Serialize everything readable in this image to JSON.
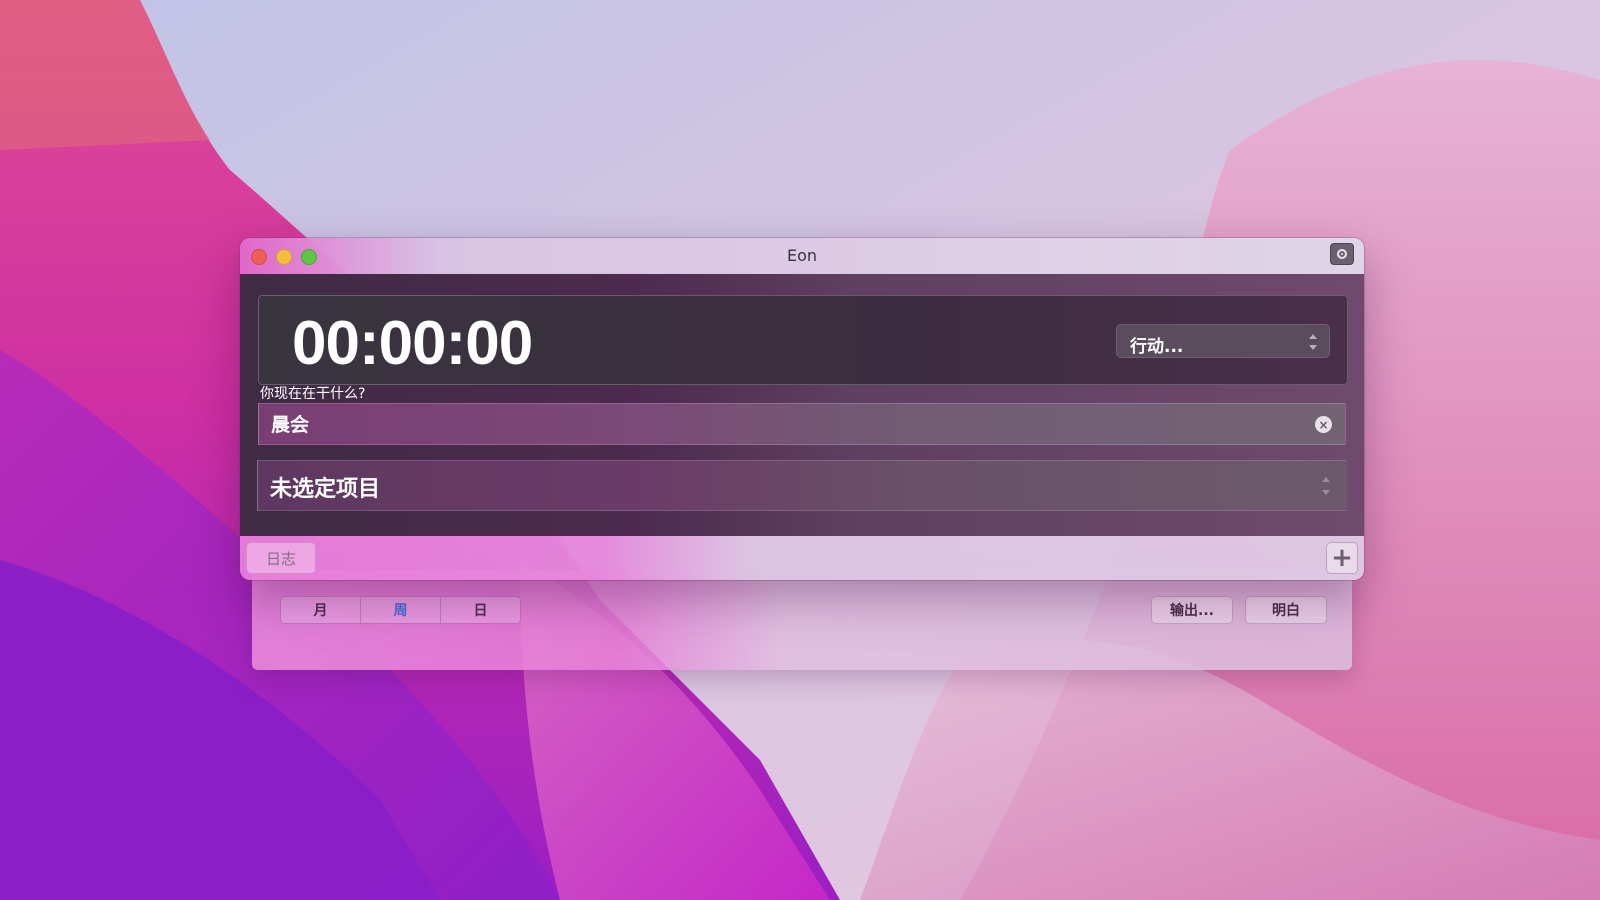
{
  "window": {
    "title": "Eon"
  },
  "timer": {
    "value": "00:00:00",
    "action_label": "行动..."
  },
  "activity": {
    "prompt": "你现在在干什么?",
    "value": "晨会",
    "clear_icon": "×"
  },
  "project": {
    "label": "未选定项目"
  },
  "bottombar": {
    "log_label": "日志",
    "add_icon": "+"
  },
  "log_panel": {
    "segments": [
      {
        "label": "月",
        "active": false
      },
      {
        "label": "周",
        "active": true
      },
      {
        "label": "日",
        "active": false
      }
    ],
    "export_label": "输出...",
    "tomorrow_label": "明白"
  },
  "icons": {
    "close": "traffic-close-icon",
    "minimize": "traffic-minimize-icon",
    "zoom": "traffic-zoom-icon",
    "record": "record-icon",
    "stepper": "chevron-up-down-icon",
    "clear": "clear-circle-icon",
    "add": "plus-icon"
  },
  "colors": {
    "close": "#ed5e57",
    "minimize": "#f4bd3f",
    "zoom": "#5ec545",
    "active_segment": "#3f6fd6"
  }
}
